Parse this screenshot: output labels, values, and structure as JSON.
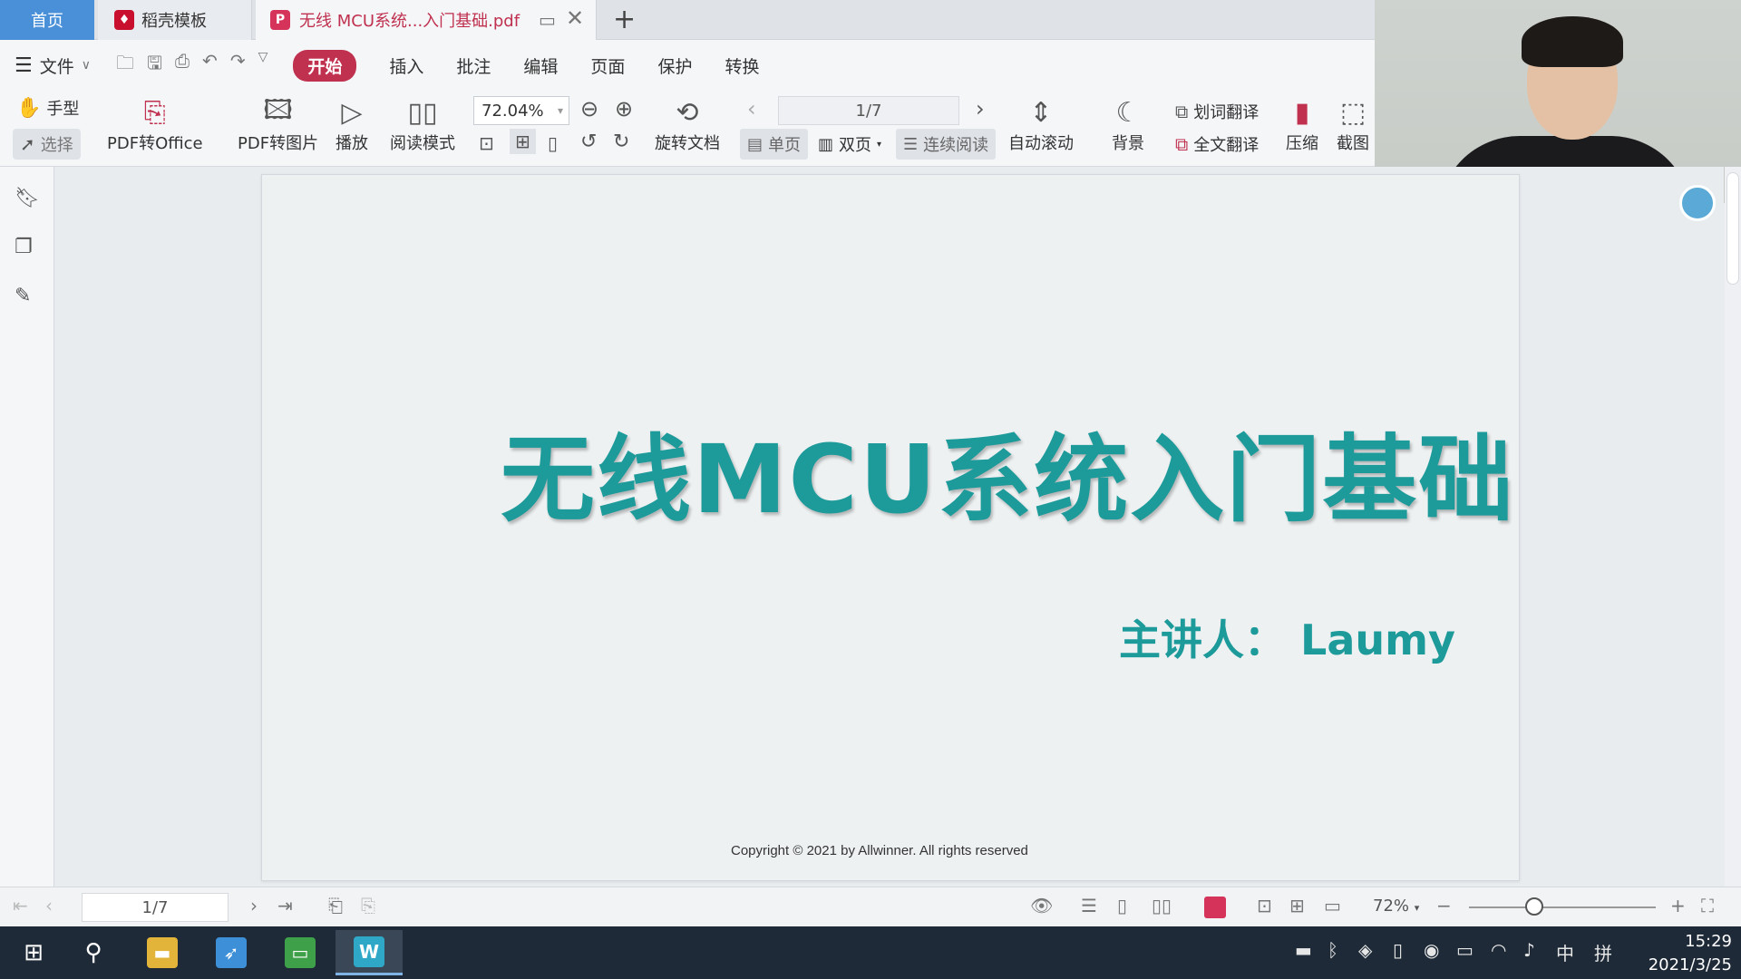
{
  "tabs": {
    "home": "首页",
    "template": "稻壳模板",
    "document": "无线 MCU系统...入门基础.pdf"
  },
  "menu": {
    "file": "文件",
    "items": [
      "开始",
      "插入",
      "批注",
      "编辑",
      "页面",
      "保护",
      "转换"
    ],
    "active": "开始"
  },
  "ribbon": {
    "hand": "手型",
    "select": "选择",
    "pdf_to_office": "PDF转Office",
    "pdf_to_image": "PDF转图片",
    "play": "播放",
    "read_mode": "阅读模式",
    "zoom": "72.04%",
    "rotate": "旋转文档",
    "page_indicator": "1/7",
    "single_page": "单页",
    "double_page": "双页",
    "continuous": "连续阅读",
    "auto_scroll": "自动滚动",
    "background": "背景",
    "word_translate": "划词翻译",
    "full_translate": "全文翻译",
    "compress": "压缩",
    "screenshot": "截图"
  },
  "document": {
    "title": "无线MCU系统入门基础",
    "speaker": "主讲人：  Laumy",
    "copyright": "Copyright © 2021 by Allwinner. All rights reserved",
    "title_color": "#1d9a9a"
  },
  "statusbar": {
    "page": "1/7",
    "zoom": "72%",
    "zoom_level_percent": 72
  },
  "taskbar": {
    "ime": "中",
    "ime2": "拼",
    "time": "15:29",
    "date": "2021/3/25"
  },
  "colors": {
    "accent": "#c0304f",
    "home_tab": "#4a90d9",
    "taskbar": "#1e2a38"
  }
}
